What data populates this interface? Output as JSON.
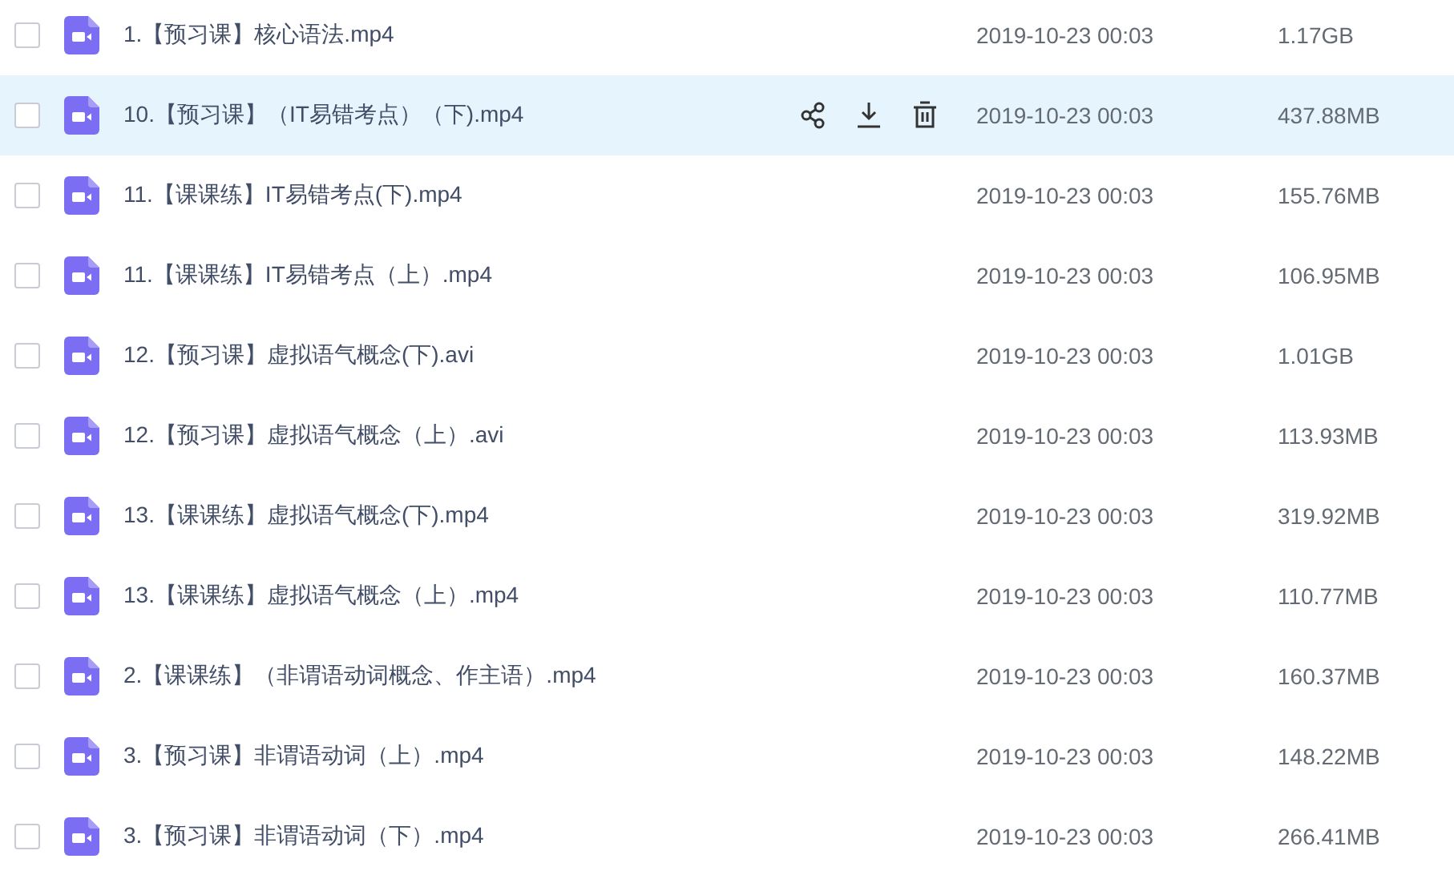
{
  "files": [
    {
      "name": "1.【预习课】核心语法.mp4",
      "date": "2019-10-23 00:03",
      "size": "1.17GB",
      "checked": false,
      "highlighted": false
    },
    {
      "name": "10.【预习课】（IT易错考点）（下).mp4",
      "date": "2019-10-23 00:03",
      "size": "437.88MB",
      "checked": false,
      "highlighted": true
    },
    {
      "name": "11.【课课练】IT易错考点(下).mp4",
      "date": "2019-10-23 00:03",
      "size": "155.76MB",
      "checked": false,
      "highlighted": false
    },
    {
      "name": "11.【课课练】IT易错考点（上）.mp4",
      "date": "2019-10-23 00:03",
      "size": "106.95MB",
      "checked": false,
      "highlighted": false
    },
    {
      "name": "12.【预习课】虚拟语气概念(下).avi",
      "date": "2019-10-23 00:03",
      "size": "1.01GB",
      "checked": false,
      "highlighted": false
    },
    {
      "name": "12.【预习课】虚拟语气概念（上）.avi",
      "date": "2019-10-23 00:03",
      "size": "113.93MB",
      "checked": false,
      "highlighted": false
    },
    {
      "name": "13.【课课练】虚拟语气概念(下).mp4",
      "date": "2019-10-23 00:03",
      "size": "319.92MB",
      "checked": false,
      "highlighted": false
    },
    {
      "name": "13.【课课练】虚拟语气概念（上）.mp4",
      "date": "2019-10-23 00:03",
      "size": "110.77MB",
      "checked": false,
      "highlighted": false
    },
    {
      "name": "2.【课课练】（非谓语动词概念、作主语）.mp4",
      "date": "2019-10-23 00:03",
      "size": "160.37MB",
      "checked": false,
      "highlighted": false
    },
    {
      "name": "3.【预习课】非谓语动词（上）.mp4",
      "date": "2019-10-23 00:03",
      "size": "148.22MB",
      "checked": false,
      "highlighted": false
    },
    {
      "name": "3.【预习课】非谓语动词（下）.mp4",
      "date": "2019-10-23 00:03",
      "size": "266.41MB",
      "checked": false,
      "highlighted": false
    }
  ]
}
